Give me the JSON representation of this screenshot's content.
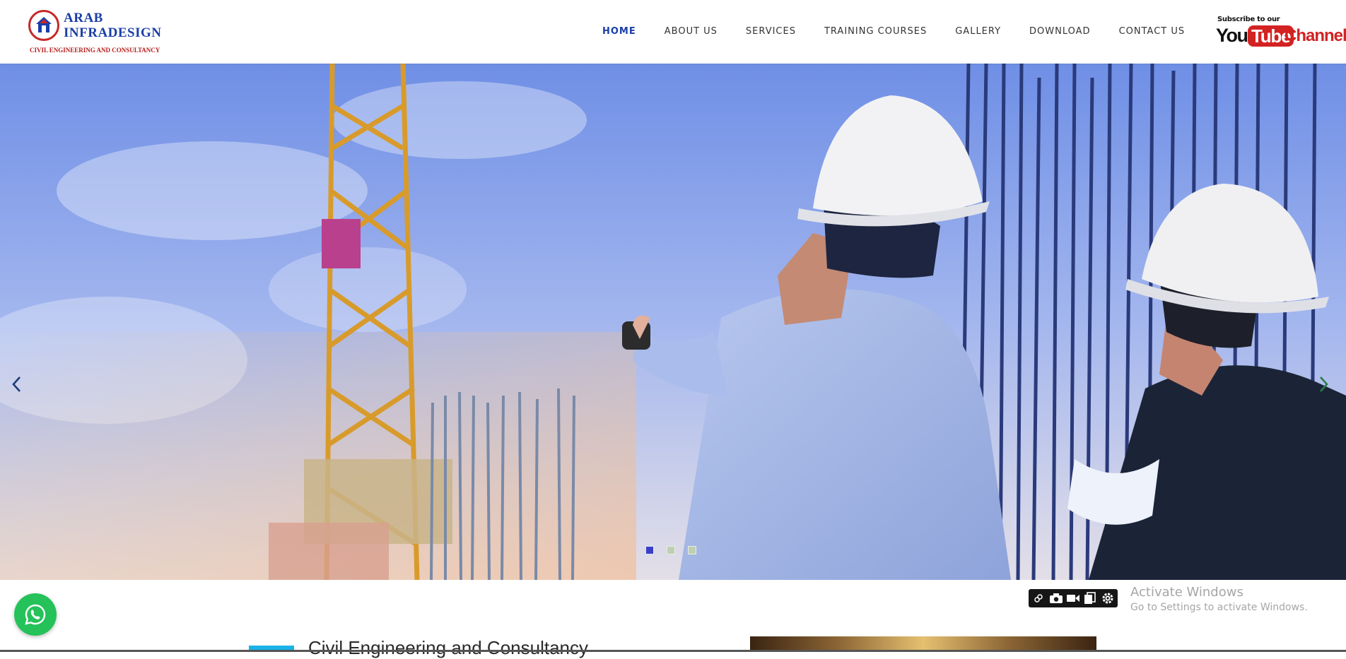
{
  "brand": {
    "name_line1": "ARAB",
    "name_line2": "INFRADESIGN",
    "tagline": "CIVIL ENGINEERING AND CONSULTANCY"
  },
  "nav": {
    "items": [
      {
        "label": "HOME",
        "active": true
      },
      {
        "label": "ABOUT US",
        "active": false
      },
      {
        "label": "SERVICES",
        "active": false
      },
      {
        "label": "TRAINING COURSES",
        "active": false
      },
      {
        "label": "GALLERY",
        "active": false
      },
      {
        "label": "DOWNLOAD",
        "active": false
      },
      {
        "label": "CONTACT US",
        "active": false
      }
    ]
  },
  "youtube": {
    "subscribe_text": "Subscribe to our",
    "you": "You",
    "tube": "Tube",
    "channel": "Channel"
  },
  "hero": {
    "image_icon": "construction-engineers-photo",
    "slides_total": 3,
    "active_slide": 1,
    "prev_icon": "chevron-left-icon",
    "next_icon": "chevron-right-icon"
  },
  "whatsapp": {
    "icon": "whatsapp-icon",
    "color": "#25c25a"
  },
  "capture_toolbar": {
    "icons": [
      "link-icon",
      "camera-icon",
      "video-icon",
      "copy-icon",
      "gear-icon"
    ]
  },
  "windows_activation": {
    "title": "Activate Windows",
    "subtitle": "Go to Settings to activate Windows."
  },
  "section": {
    "title": "Civil Engineering and Consultancy",
    "accent_color": "#1ab3e8"
  },
  "colors": {
    "brand_blue": "#1a3ea8",
    "brand_red": "#c62828",
    "active_dot": "#3a3fc6"
  }
}
